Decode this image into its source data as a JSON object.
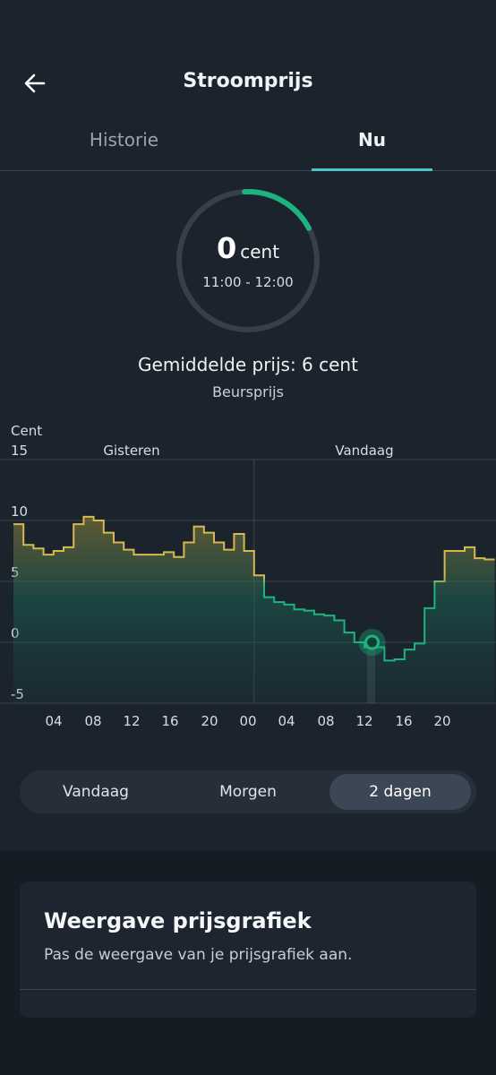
{
  "header": {
    "title": "Stroomprijs",
    "back_icon": "arrow-left-icon"
  },
  "tabs": [
    {
      "label": "Historie",
      "active": false
    },
    {
      "label": "Nu",
      "active": true
    }
  ],
  "gauge": {
    "value": "0",
    "unit": "cent",
    "time": "11:00 - 12:00",
    "fraction": 0.18,
    "color": "#1db37f"
  },
  "average": {
    "text": "Gemiddelde prijs: 6 cent",
    "sub": "Beursprijs"
  },
  "chart_data": {
    "type": "area",
    "ylabel": "Cent",
    "ylim": [
      -5,
      15
    ],
    "yticks": [
      "15",
      "10",
      "5",
      "0",
      "-5"
    ],
    "day_labels": [
      "Gisteren",
      "Vandaag"
    ],
    "xticks": [
      "04",
      "08",
      "12",
      "16",
      "20",
      "00",
      "04",
      "08",
      "12",
      "16",
      "20"
    ],
    "x_hours": [
      0,
      1,
      2,
      3,
      4,
      5,
      6,
      7,
      8,
      9,
      10,
      11,
      12,
      13,
      14,
      15,
      16,
      17,
      18,
      19,
      20,
      21,
      22,
      23,
      24,
      25,
      26,
      27,
      28,
      29,
      30,
      31,
      32,
      33,
      34,
      35,
      36,
      37,
      38,
      39,
      40,
      41,
      42,
      43,
      44,
      45,
      46,
      47
    ],
    "values": [
      9.7,
      8.0,
      7.7,
      7.2,
      7.5,
      7.8,
      9.7,
      10.3,
      10.0,
      9.0,
      8.2,
      7.6,
      7.2,
      7.2,
      7.2,
      7.4,
      7.0,
      8.2,
      9.5,
      9.0,
      8.2,
      7.6,
      8.9,
      7.5,
      5.5,
      3.7,
      3.3,
      3.1,
      2.7,
      2.6,
      2.3,
      2.2,
      1.8,
      0.8,
      0.0,
      -0.4,
      -0.4,
      -1.5,
      -1.4,
      -0.6,
      -0.1,
      2.8,
      5.0,
      7.5,
      7.5,
      7.8,
      6.9,
      6.8
    ],
    "current_hour": 35,
    "current_value": 0,
    "colors": {
      "high": "#d6b94e",
      "low": "#1db37f"
    }
  },
  "segmented": {
    "options": [
      "Vandaag",
      "Morgen",
      "2 dagen"
    ],
    "selected": 2
  },
  "card": {
    "title": "Weergave prijsgrafiek",
    "subtitle": "Pas de weergave van je prijsgrafiek aan."
  }
}
